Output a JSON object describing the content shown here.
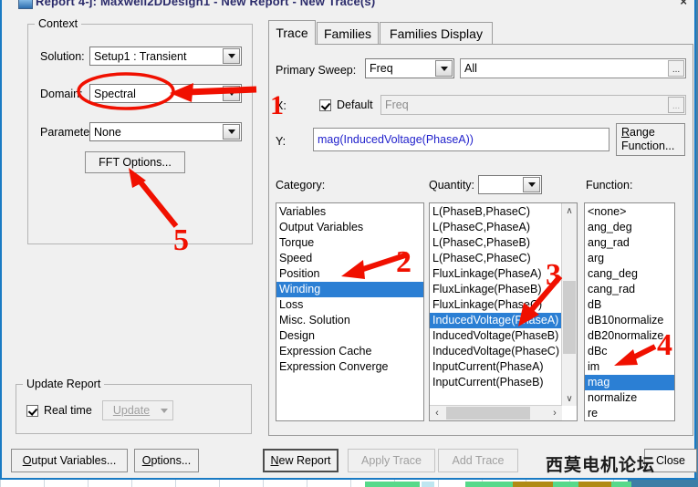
{
  "window": {
    "title": "Report 4-j: Maxwell2DDesign1 - New Report - New Trace(s)",
    "close_glyph": "×",
    "icon": "report-icon"
  },
  "context": {
    "group_label": "Context",
    "solution_label": "Solution:",
    "solution_value": "Setup1 : Transient",
    "domain_label": "Domain:",
    "domain_value": "Spectral",
    "parameter_label": "Parameter:",
    "parameter_value": "None",
    "fft_button": "FFT Options..."
  },
  "update_report": {
    "group_label": "Update Report",
    "realtime_label": "Real time",
    "realtime_checked": true,
    "update_button": "Update"
  },
  "footer_left": {
    "output_variables_button": "Output Variables...",
    "output_variables_accel": "O",
    "options_button": "Options...",
    "options_accel": "O"
  },
  "tabs": [
    {
      "label": "Trace",
      "active": true
    },
    {
      "label": "Families",
      "active": false
    },
    {
      "label": "Families Display",
      "active": false
    }
  ],
  "trace": {
    "primary_sweep_label": "Primary Sweep:",
    "primary_sweep_value": "Freq",
    "sweep_range_value": "All",
    "sweep_range_ellipsis": "...",
    "x_label": "X:",
    "x_default_label": "Default",
    "x_default_checked": true,
    "x_value": "Freq",
    "x_ellipsis": "...",
    "y_label": "Y:",
    "y_value": "mag(InducedVoltage(PhaseA))",
    "range_function_button_line1": "Range",
    "range_function_button_line2": "Function...",
    "range_function_accel": "R"
  },
  "category": {
    "label": "Category:",
    "items": [
      "Variables",
      "Output Variables",
      "Torque",
      "Speed",
      "Position",
      "Winding",
      "Loss",
      "Misc. Solution",
      "Design",
      "Expression Cache",
      "Expression Converge"
    ],
    "selected": "Winding"
  },
  "quantity": {
    "label": "Quantity:",
    "filter_value": "",
    "items": [
      "L(PhaseB,PhaseC)",
      "L(PhaseC,PhaseA)",
      "L(PhaseC,PhaseB)",
      "L(PhaseC,PhaseC)",
      "FluxLinkage(PhaseA)",
      "FluxLinkage(PhaseB)",
      "FluxLinkage(PhaseC)",
      "InducedVoltage(PhaseA)",
      "InducedVoltage(PhaseB)",
      "InducedVoltage(PhaseC)",
      "InputCurrent(PhaseA)",
      "InputCurrent(PhaseB)"
    ],
    "selected": "InducedVoltage(PhaseA)",
    "scroll_up_glyph": "∧",
    "scroll_down_glyph": "∨",
    "scroll_left_glyph": "‹",
    "scroll_right_glyph": "›"
  },
  "function": {
    "label": "Function:",
    "items": [
      "<none>",
      "ang_deg",
      "ang_rad",
      "arg",
      "cang_deg",
      "cang_rad",
      "dB",
      "dB10normalize",
      "dB20normalize",
      "dBc",
      "im",
      "mag",
      "normalize",
      "re"
    ],
    "selected": "mag"
  },
  "footer_right": {
    "new_report_button": "New Report",
    "new_report_accel": "N",
    "apply_trace_button": "Apply Trace",
    "add_trace_button": "Add Trace",
    "close_button": "Close"
  },
  "annotations": {
    "numbers": [
      "1",
      "2",
      "3",
      "4",
      "5"
    ],
    "color": "#f01000",
    "ellipse_target": "domain-combo"
  },
  "watermark": {
    "text": "西莫电机论坛"
  }
}
